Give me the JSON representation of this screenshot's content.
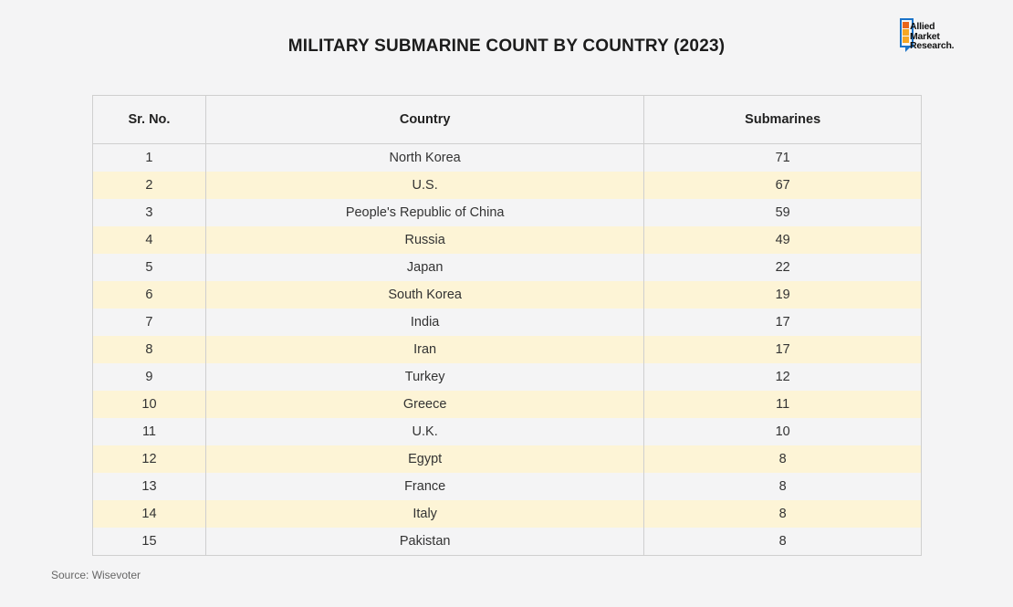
{
  "header": {
    "title": "MILITARY SUBMARINE COUNT BY COUNTRY (2023)"
  },
  "logo": {
    "lines": [
      "Allied",
      "Market",
      "Research."
    ],
    "colors": [
      "#e8641b",
      "#f5a623",
      "#1a73c9"
    ]
  },
  "chart_data": {
    "type": "table",
    "title": "MILITARY SUBMARINE COUNT BY COUNTRY (2023)",
    "columns": [
      "Sr. No.",
      "Country",
      "Submarines"
    ],
    "rows": [
      [
        "1",
        "North Korea",
        "71"
      ],
      [
        "2",
        "U.S.",
        "67"
      ],
      [
        "3",
        "People's Republic of China",
        "59"
      ],
      [
        "4",
        "Russia",
        "49"
      ],
      [
        "5",
        "Japan",
        "22"
      ],
      [
        "6",
        "South Korea",
        "19"
      ],
      [
        "7",
        "India",
        "17"
      ],
      [
        "8",
        "Iran",
        "17"
      ],
      [
        "9",
        "Turkey",
        "12"
      ],
      [
        "10",
        "Greece",
        "11"
      ],
      [
        "11",
        "U.K.",
        "10"
      ],
      [
        "12",
        "Egypt",
        "8"
      ],
      [
        "13",
        "France",
        "8"
      ],
      [
        "14",
        "Italy",
        "8"
      ],
      [
        "15",
        "Pakistan",
        "8"
      ]
    ],
    "row_colors": {
      "odd": "#f4f4f5",
      "even": "#fdf4d6"
    }
  },
  "footer": {
    "source": "Source: Wisevoter"
  }
}
